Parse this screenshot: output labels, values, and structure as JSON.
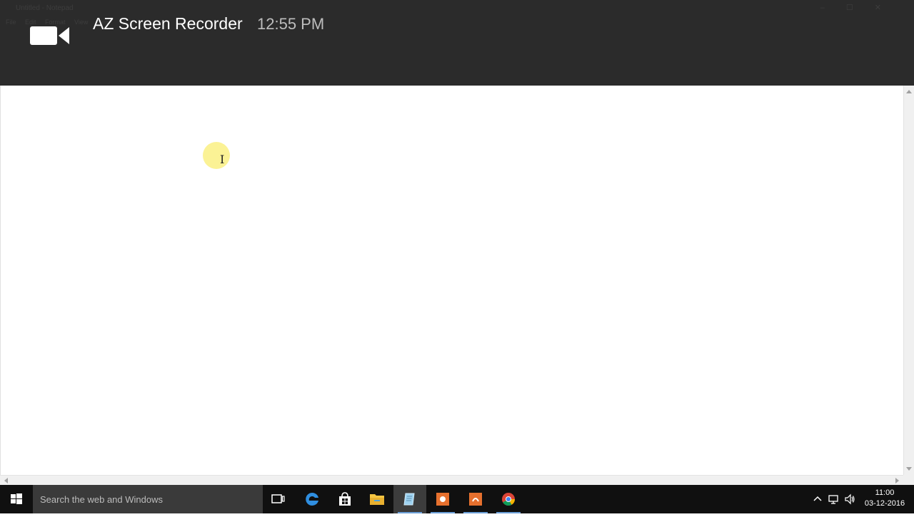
{
  "recorder": {
    "app_name": "AZ Screen Recorder",
    "time": "12:55 PM",
    "icon": "video-camera-icon"
  },
  "window": {
    "faint_title": "Untitled - Notepad",
    "faint_menu": "File Edit Format View Help"
  },
  "taskbar": {
    "search_placeholder": "Search the web and Windows",
    "apps": [
      {
        "name": "task-view",
        "icon": "task-view-icon"
      },
      {
        "name": "edge",
        "icon": "edge-icon"
      },
      {
        "name": "store",
        "icon": "store-icon"
      },
      {
        "name": "file-explorer",
        "icon": "folder-icon"
      },
      {
        "name": "notepad",
        "icon": "notepad-icon"
      },
      {
        "name": "powerpoint-1",
        "icon": "orange-app-icon"
      },
      {
        "name": "powerpoint-2",
        "icon": "orange-app-icon"
      },
      {
        "name": "chrome",
        "icon": "chrome-icon"
      }
    ],
    "clock": {
      "time": "11:00",
      "date": "03-12-2016"
    }
  },
  "colors": {
    "banner_bg": "#2b2b2b",
    "taskbar_bg": "#101010",
    "cursor_highlight": "#fbf18a",
    "accent": "#6b9fd8"
  }
}
